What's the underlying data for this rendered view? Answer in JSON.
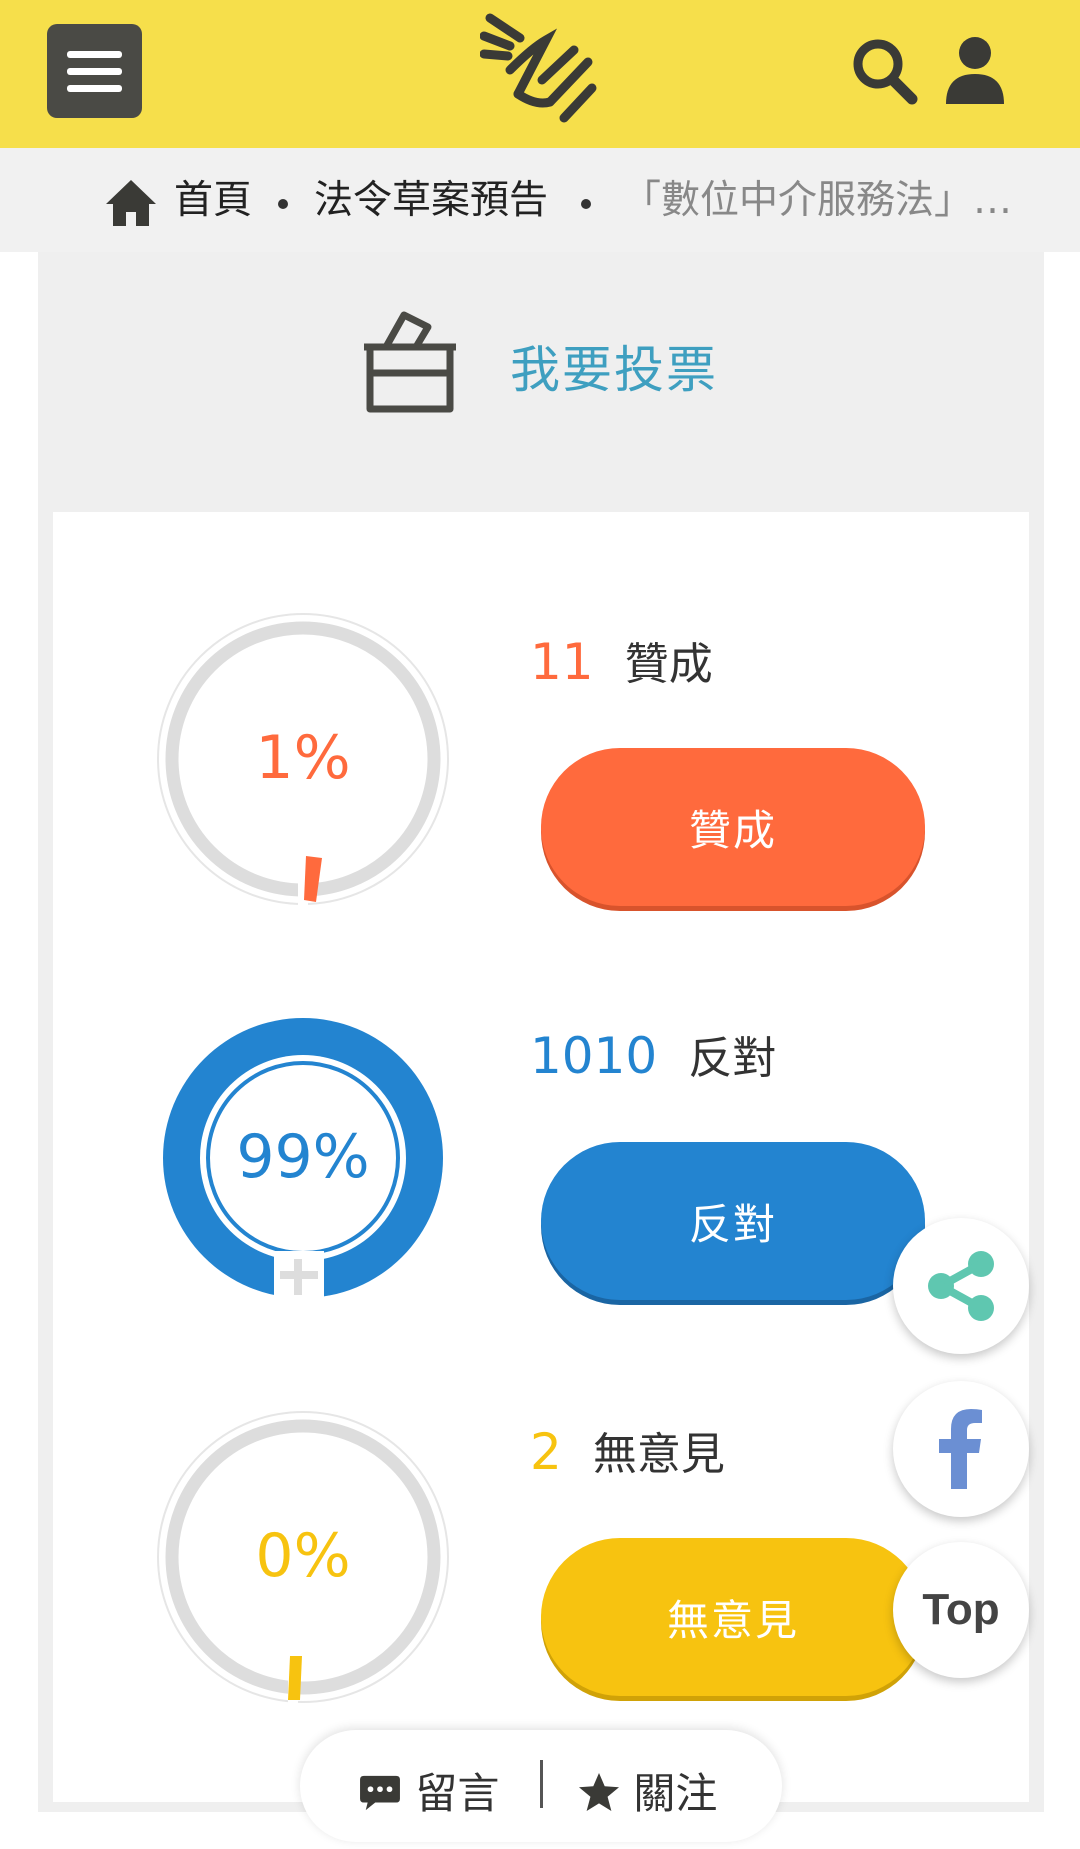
{
  "header": {
    "menu_icon": "hamburger-icon",
    "logo_icon": "site-logo-hand-icon",
    "search_icon": "search-icon",
    "user_icon": "user-icon",
    "bg_color": "#f6df4b"
  },
  "breadcrumb": {
    "home_icon": "home-icon",
    "items": [
      "首頁",
      "法令草案預告",
      "「數位中介服務法」…"
    ]
  },
  "vote": {
    "title": "我要投票",
    "title_icon": "ballot-box-icon",
    "options": [
      {
        "count": "11",
        "label": "贊成",
        "percent_text": "1%",
        "percent": 1,
        "button": "贊成",
        "color": "#ff6a3d"
      },
      {
        "count": "1010",
        "label": "反對",
        "percent_text": "99%",
        "percent": 99,
        "button": "反對",
        "color": "#2384d0"
      },
      {
        "count": "2",
        "label": "無意見",
        "percent_text": "0%",
        "percent": 0,
        "button": "無意見",
        "color": "#f7c310"
      }
    ]
  },
  "floating": {
    "share_icon": "share-icon",
    "facebook_icon": "facebook-icon",
    "top_label": "Top"
  },
  "bottom_bar": {
    "comment_icon": "comment-icon",
    "comment_label": "留言",
    "follow_icon": "star-icon",
    "follow_label": "關注"
  }
}
